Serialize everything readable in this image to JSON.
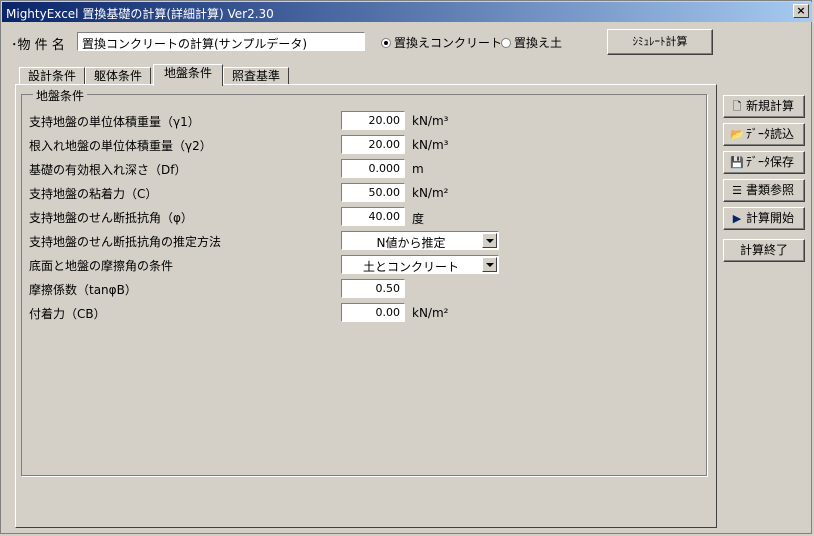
{
  "window": {
    "title": "MightyExcel 置換基礎の計算(詳細計算) Ver2.30",
    "close": "×"
  },
  "property": {
    "label": "･物 件 名",
    "value": "置換コンクリートの計算(サンプルデータ)"
  },
  "radios": [
    {
      "label": "置換えコンクリート",
      "checked": true
    },
    {
      "label": "置換え土",
      "checked": false
    }
  ],
  "simulate_label": "ｼﾐｭﾚｰﾄ計算",
  "tabs": [
    {
      "label": "設計条件",
      "active": false
    },
    {
      "label": "躯体条件",
      "active": false
    },
    {
      "label": "地盤条件",
      "active": true
    },
    {
      "label": "照査基準",
      "active": false
    }
  ],
  "group": {
    "title": "地盤条件",
    "rows": [
      {
        "label": "支持地盤の単位体積重量（γ1）",
        "value": "20.00",
        "unit": "kN/m³"
      },
      {
        "label": "根入れ地盤の単位体積重量（γ2）",
        "value": "20.00",
        "unit": "kN/m³"
      },
      {
        "label": "基礎の有効根入れ深さ（Df）",
        "value": "0.000",
        "unit": "m"
      },
      {
        "label": "支持地盤の粘着力（C）",
        "value": "50.00",
        "unit": "kN/m²"
      },
      {
        "label": "支持地盤のせん断抵抗角（φ）",
        "value": "40.00",
        "unit": "度"
      },
      {
        "label": "支持地盤のせん断抵抗角の推定方法",
        "select": "N値から推定"
      },
      {
        "label": "底面と地盤の摩擦角の条件",
        "select": "土とコンクリート"
      },
      {
        "label": "摩擦係数（tanφB）",
        "value": "0.50",
        "unit": ""
      },
      {
        "label": "付着力（CB）",
        "value": "0.00",
        "unit": "kN/m²"
      }
    ]
  },
  "side_buttons": [
    {
      "label": "新規計算",
      "icon": "new-document-icon"
    },
    {
      "label": "ﾃﾞｰﾀ読込",
      "icon": "open-folder-icon"
    },
    {
      "label": "ﾃﾞｰﾀ保存",
      "icon": "floppy-disk-icon"
    },
    {
      "label": "書類参照",
      "icon": "document-list-icon"
    },
    {
      "label": "計算開始",
      "icon": "play-arrow-icon"
    },
    {
      "label": "計算終了",
      "icon": ""
    }
  ]
}
